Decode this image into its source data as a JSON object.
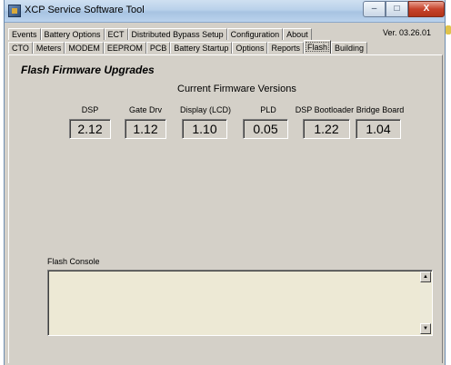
{
  "window": {
    "title": "XCP Service Software Tool",
    "version": "Ver. 03.26.01",
    "controls": {
      "minimize": "–",
      "maximize": "□",
      "close": "X"
    }
  },
  "tabs": {
    "row1": [
      "Events",
      "Battery Options",
      "ECT",
      "Distributed Bypass Setup",
      "Configuration",
      "About"
    ],
    "row2": [
      "CTO",
      "Meters",
      "MODEM",
      "EEPROM",
      "PCB",
      "Battery Startup",
      "Options",
      "Reports",
      "Flash",
      "Building"
    ],
    "active": "Flash"
  },
  "page": {
    "title": "Flash Firmware Upgrades",
    "section_title": "Current Firmware Versions",
    "firmware": [
      {
        "label": "DSP",
        "value": "2.12"
      },
      {
        "label": "Gate Drv",
        "value": "1.12"
      },
      {
        "label": "Display (LCD)",
        "value": "1.10"
      },
      {
        "label": "PLD",
        "value": "0.05"
      },
      {
        "label": "DSP Bootloader",
        "value": "1.22"
      },
      {
        "label": "Bridge Board",
        "value": "1.04"
      }
    ],
    "console_label": "Flash Console",
    "console_text": ""
  },
  "icons": {
    "app": "app-icon",
    "scroll_up": "▲",
    "scroll_down": "▼"
  }
}
